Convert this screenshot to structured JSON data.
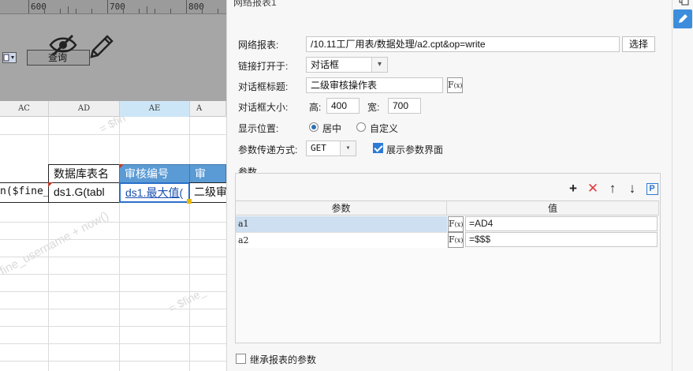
{
  "ruler": {
    "ticks": [
      "600",
      "700",
      "800"
    ]
  },
  "parameter_pane": {
    "query_button_label": "查询"
  },
  "sheet": {
    "columns": [
      {
        "name": "AC",
        "selected": false
      },
      {
        "name": "AD",
        "selected": false
      },
      {
        "name": "AE",
        "selected": true
      },
      {
        "name": "A",
        "selected": false
      }
    ],
    "header_row": [
      "数据库表名",
      "审核编号",
      "审"
    ],
    "data_row": [
      "n($fine_",
      "ds1.G(tabl",
      "ds1.最大值(",
      "二级审"
    ],
    "watermarks": [
      "= $fin",
      "fine_username + now()",
      "= $fine_"
    ]
  },
  "dialog": {
    "title": "网络报表1",
    "network_report": {
      "label": "网络报表:",
      "value": "/10.11工厂用表/数据处理/a2.cpt&op=write",
      "select_button": "选择"
    },
    "link_open": {
      "label": "链接打开于:",
      "value": "对话框"
    },
    "dialog_title": {
      "label": "对话框标题:",
      "value": "二级审核操作表"
    },
    "dialog_size": {
      "label": "对话框大小:",
      "height_label": "高:",
      "height": "400",
      "width_label": "宽:",
      "width": "700"
    },
    "display_position": {
      "label": "显示位置:",
      "options": [
        "居中",
        "自定义"
      ],
      "selected": "居中"
    },
    "param_method": {
      "label": "参数传递方式:",
      "value": "GET",
      "show_param_ui_label": "展示参数界面",
      "show_param_ui_checked": true
    },
    "params_section": {
      "label": "参数",
      "toolbar": [
        "add-icon",
        "delete-icon",
        "move-up-icon",
        "move-down-icon",
        "parameter-icon"
      ],
      "columns": [
        "参数",
        "值"
      ],
      "rows": [
        {
          "name": "a1",
          "value": "=AD4",
          "selected": true
        },
        {
          "name": "a2",
          "value": "=$$$",
          "selected": false
        }
      ]
    },
    "inherit": {
      "label": "继承报表的参数",
      "checked": false
    }
  },
  "colors": {
    "selection_blue": "#5b9bd5",
    "accent": "#2d7ad6",
    "delete_red": "#e23b3b",
    "edit_button_bg": "#3c8ddc"
  }
}
